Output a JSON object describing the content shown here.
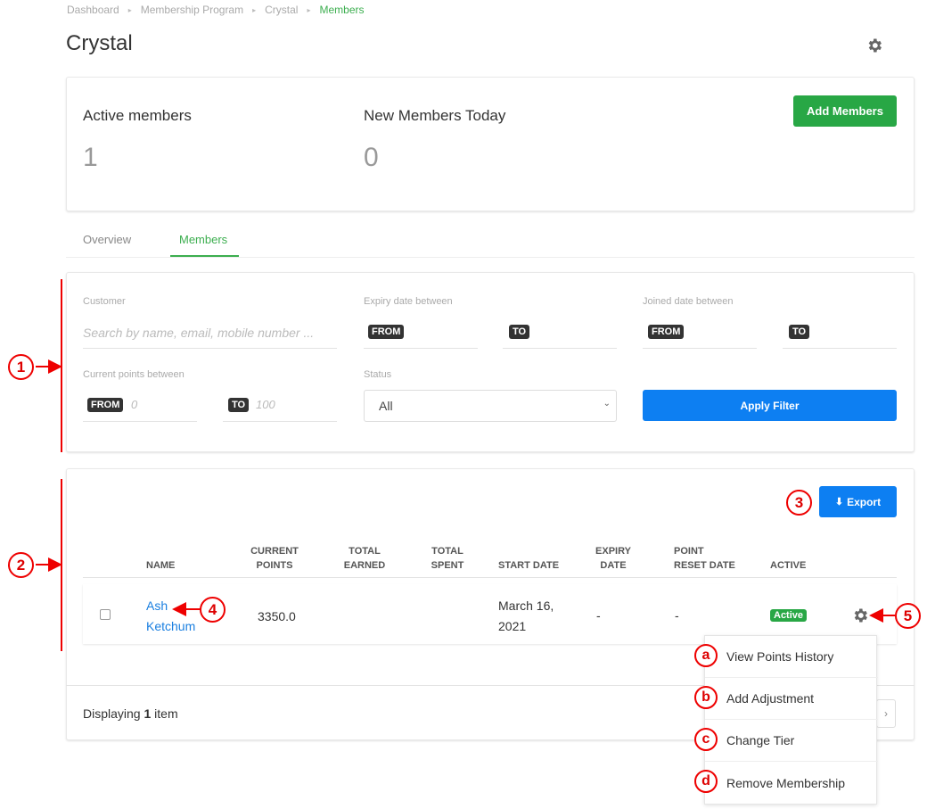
{
  "breadcrumb": [
    "Dashboard",
    "Membership Program",
    "Crystal",
    "Members"
  ],
  "page_title": "Crystal",
  "stats": {
    "active_label": "Active members",
    "active_value": "1",
    "new_label": "New Members Today",
    "new_value": "0",
    "add_button": "Add Members"
  },
  "tabs": {
    "overview": "Overview",
    "members": "Members"
  },
  "filters": {
    "customer_label": "Customer",
    "customer_placeholder": "Search by name, email, mobile number ...",
    "expiry_label": "Expiry date between",
    "joined_label": "Joined date between",
    "points_label": "Current points between",
    "status_label": "Status",
    "status_value": "All",
    "from": "FROM",
    "to": "TO",
    "points_from_placeholder": "0",
    "points_to_placeholder": "100",
    "apply_button": "Apply Filter"
  },
  "export_button": "Export",
  "table": {
    "headers": {
      "name": "NAME",
      "current_points_1": "CURRENT",
      "current_points_2": "POINTS",
      "total_earned_1": "TOTAL",
      "total_earned_2": "EARNED",
      "total_spent_1": "TOTAL",
      "total_spent_2": "SPENT",
      "start_date": "START DATE",
      "expiry_date_1": "EXPIRY",
      "expiry_date_2": "DATE",
      "point_reset_1": "POINT",
      "point_reset_2": "RESET DATE",
      "active": "ACTIVE"
    },
    "row": {
      "name_1": "Ash",
      "name_2": "Ketchum",
      "current_points": "3350.0",
      "start_date_1": "March 16,",
      "start_date_2": "2021",
      "expiry_date": "-",
      "point_reset_date": "-",
      "active": "Active"
    }
  },
  "footer": {
    "prefix": "Displaying",
    "count": "1",
    "suffix": "item",
    "pager_next": "›"
  },
  "menu": {
    "view_points_history": "View Points History",
    "add_adjustment": "Add Adjustment",
    "change_tier": "Change Tier",
    "remove_membership": "Remove Membership"
  },
  "callouts": {
    "c1": "1",
    "c2": "2",
    "c3": "3",
    "c4": "4",
    "c5": "5",
    "ca": "a",
    "cb": "b",
    "cc": "c",
    "cd": "d"
  },
  "colors": {
    "green": "#28a745",
    "blue": "#0d7ff2",
    "callout_red": "#e00000",
    "link": "#1a7fe0"
  },
  "icons": {
    "settings": "gear-icon",
    "export": "download-icon",
    "select": "chevron-down-icon"
  }
}
